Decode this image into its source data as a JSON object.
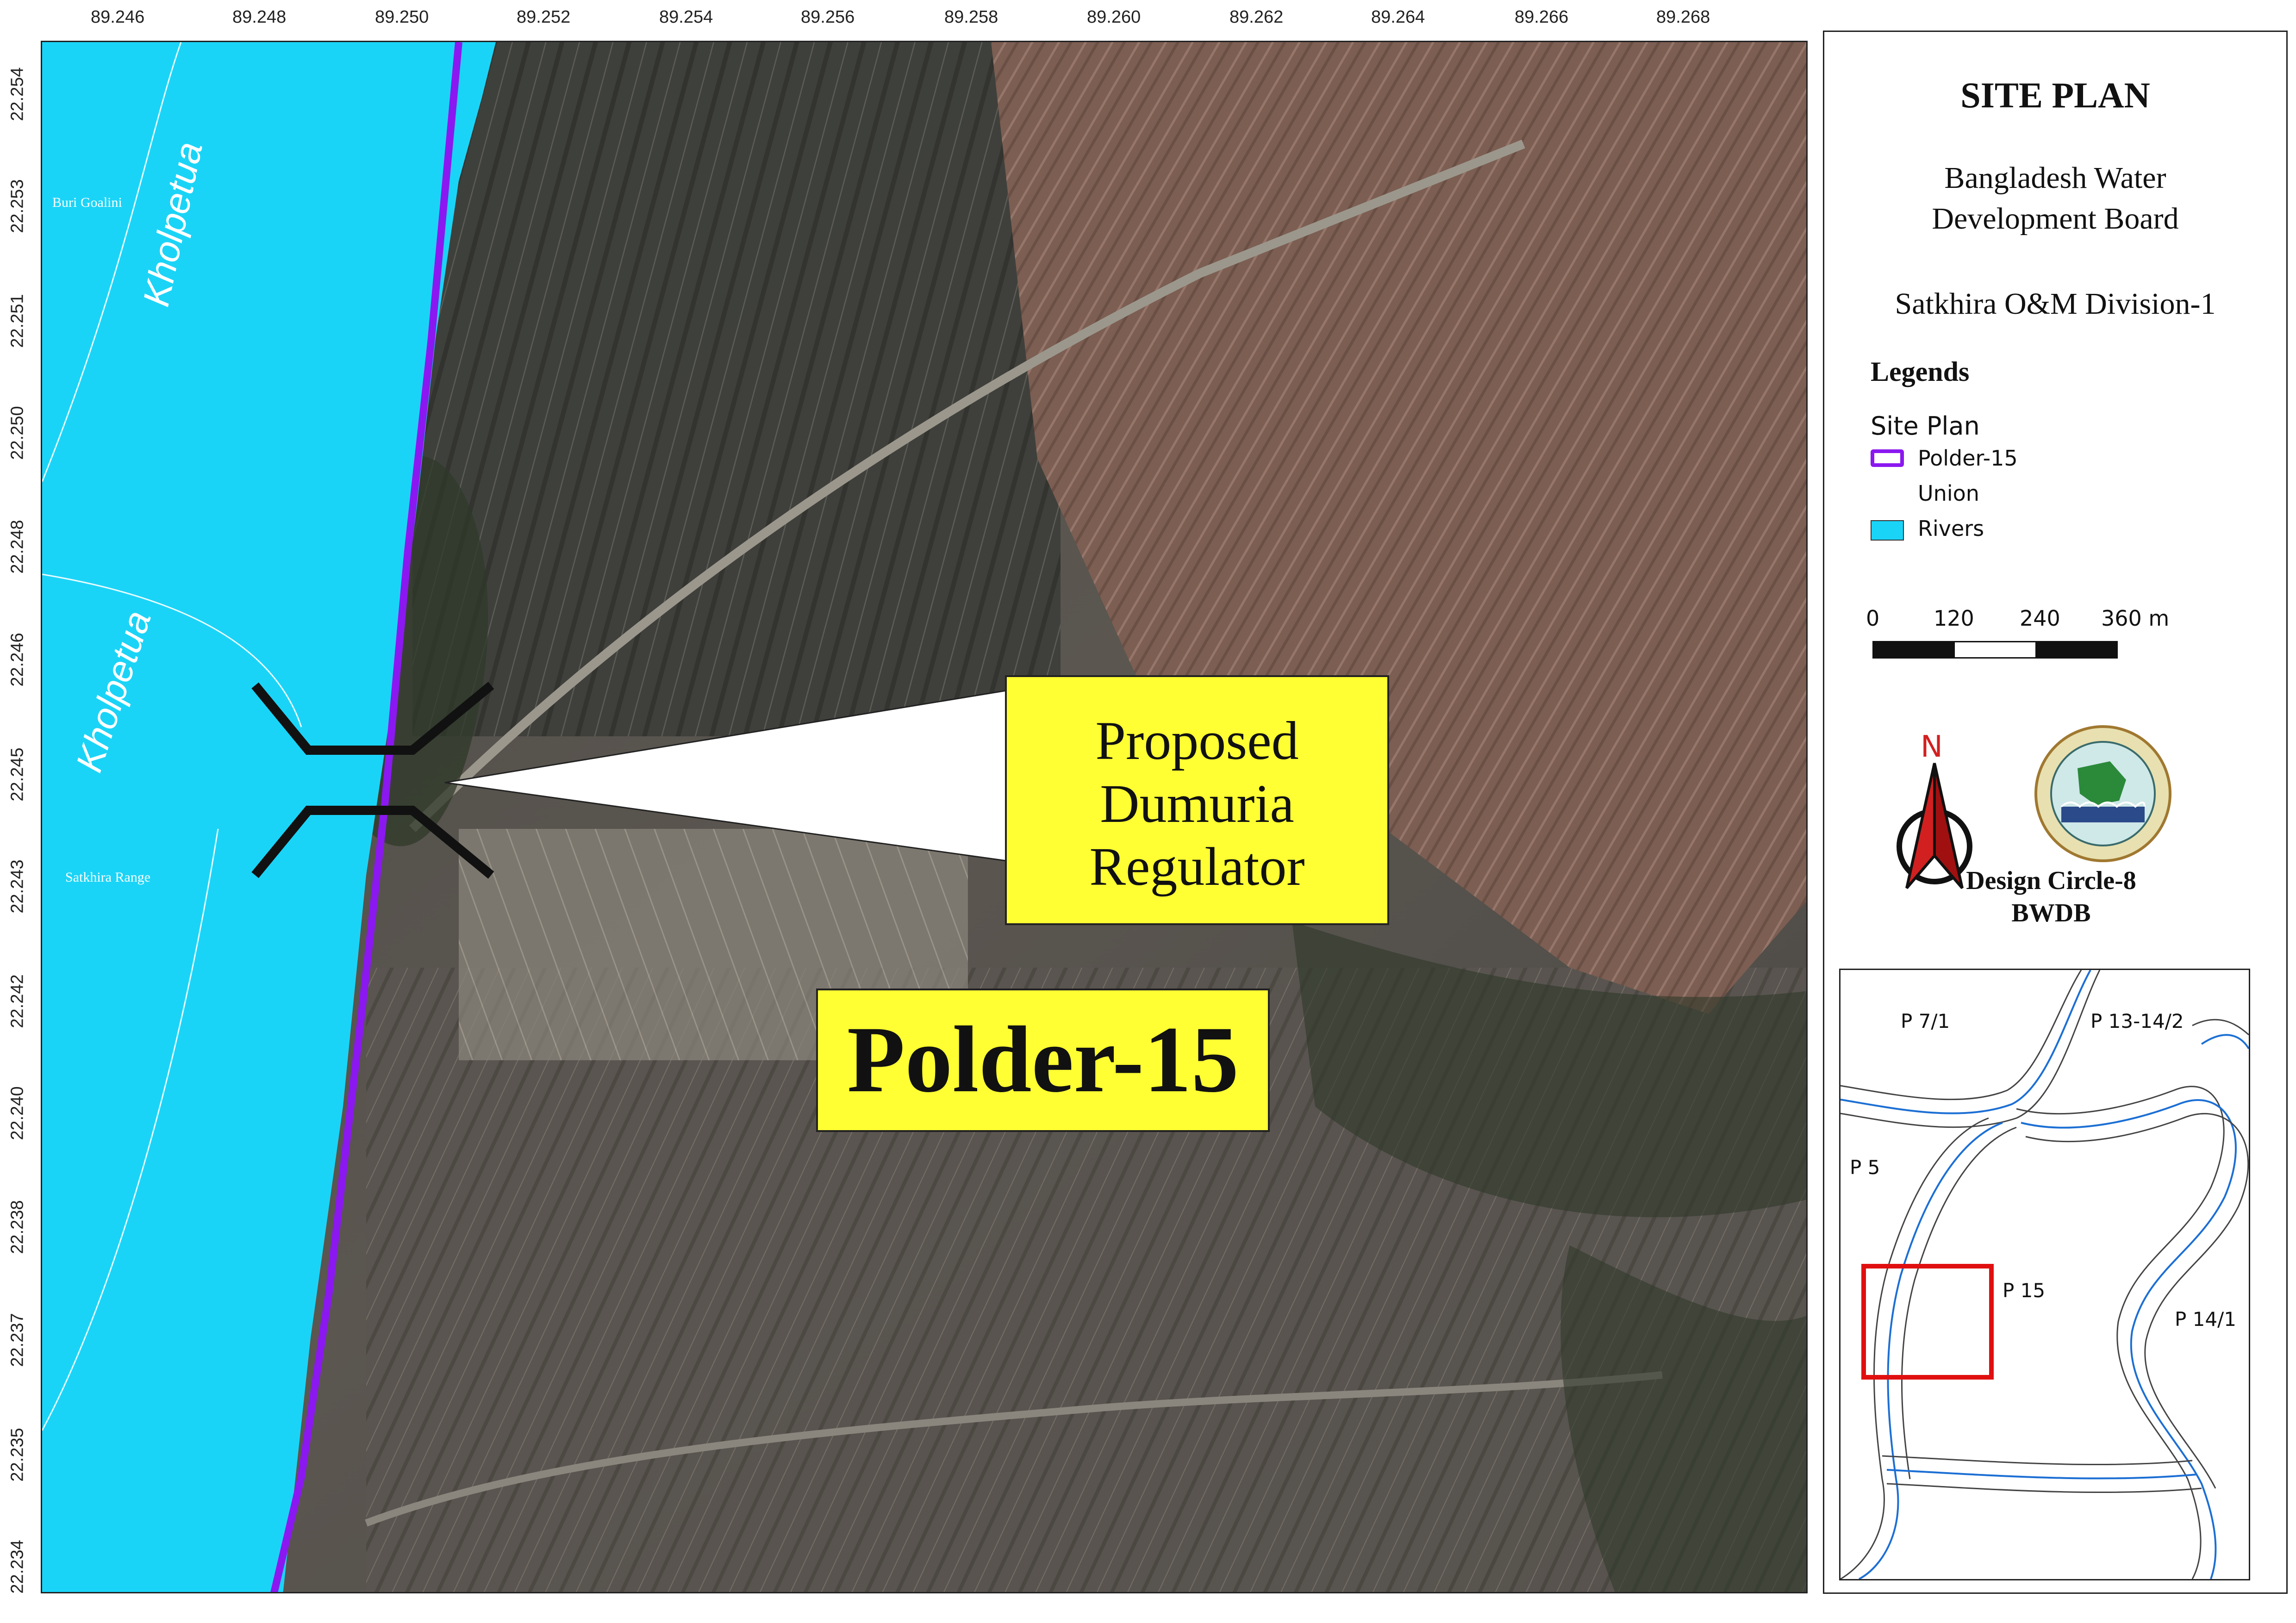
{
  "axes": {
    "x_ticks": [
      "89.246",
      "89.248",
      "89.250",
      "89.252",
      "89.254",
      "89.256",
      "89.258",
      "89.260",
      "89.262",
      "89.264",
      "89.266",
      "89.268"
    ],
    "y_ticks": [
      "22.254",
      "22.253",
      "22.251",
      "22.250",
      "22.248",
      "22.246",
      "22.245",
      "22.243",
      "22.242",
      "22.240",
      "22.238",
      "22.237",
      "22.235",
      "22.234"
    ]
  },
  "map": {
    "river_labels": [
      "Kholpetua",
      "Kholpetua"
    ],
    "small_labels": [
      "Buri Goalini",
      "Satkhira Range"
    ],
    "callout_lines": [
      "Proposed",
      "Dumuria",
      "Regulator"
    ],
    "polder_label": "Polder-15"
  },
  "sidebar": {
    "title": "SITE PLAN",
    "org_line1": "Bangladesh Water",
    "org_line2": "Development Board",
    "division": "Satkhira O&M Division-1",
    "legends_heading": "Legends",
    "legend_group": "Site Plan",
    "legend_items": [
      "Polder-15",
      "Union",
      "Rivers"
    ],
    "scale_labels": [
      "0",
      "120",
      "240",
      "360 m"
    ],
    "north_letter": "N",
    "credit_line1": "Design Circle-8",
    "credit_line2": "BWDB"
  },
  "inset": {
    "labels": [
      "P 7/1",
      "P 13-14/2",
      "P 5",
      "P 15",
      "P 14/1"
    ]
  },
  "colors": {
    "river": "#1ad4f7",
    "polder_line": "#8b18f0",
    "callout": "#ffff33",
    "inset_box": "#e01010",
    "inset_river": "#1c6fd4"
  }
}
